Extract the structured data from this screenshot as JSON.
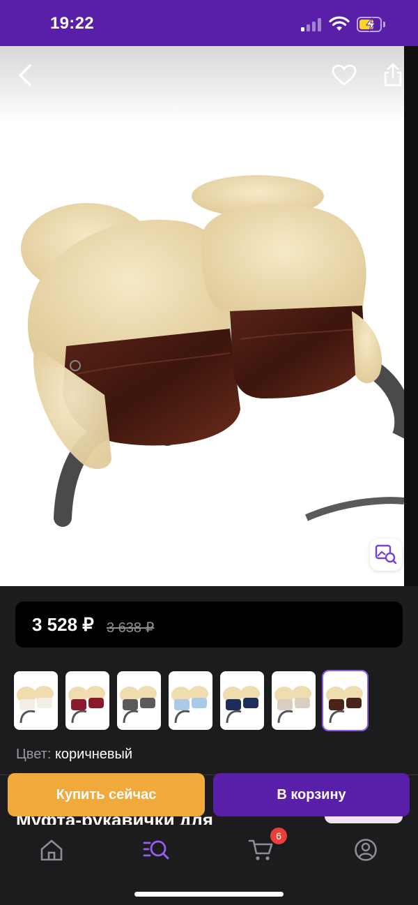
{
  "status_bar": {
    "time": "19:22"
  },
  "product": {
    "price_current": "3 528 ₽",
    "price_old": "3 638 ₽",
    "color_label": "Цвет:",
    "color_value": "коричневый",
    "title_partial": "Муфта-рукавички для",
    "variants": [
      {
        "name": "white",
        "color": "#f3efe6",
        "selected": false
      },
      {
        "name": "burgundy",
        "color": "#8a1a2e",
        "selected": false
      },
      {
        "name": "grey",
        "color": "#5a5a5c",
        "selected": false
      },
      {
        "name": "light-blue",
        "color": "#a9c9e6",
        "selected": false
      },
      {
        "name": "navy",
        "color": "#1f2d5a",
        "selected": false
      },
      {
        "name": "beige",
        "color": "#d9cfc0",
        "selected": false
      },
      {
        "name": "brown",
        "color": "#4a2418",
        "selected": true
      }
    ]
  },
  "actions": {
    "buy_now": "Купить сейчас",
    "add_to_cart": "В корзину"
  },
  "tab_bar": {
    "cart_count": "6"
  },
  "colors": {
    "accent": "#5a1fa8",
    "buy": "#f2a93b",
    "badge": "#e8403a",
    "catalog_active": "#9b5cf0"
  }
}
